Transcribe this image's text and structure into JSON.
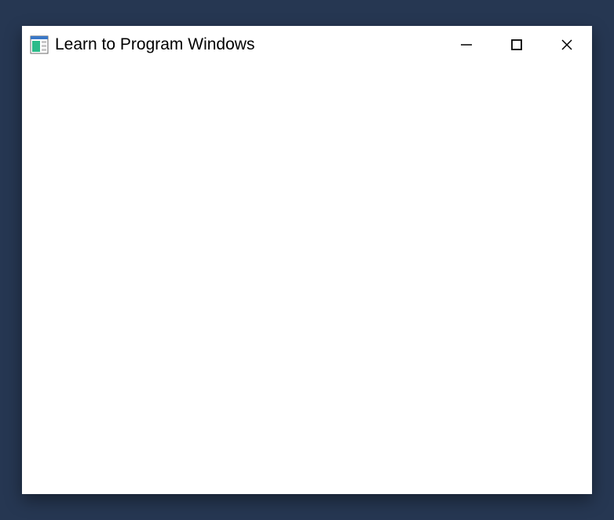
{
  "window": {
    "title": "Learn to Program Windows"
  }
}
